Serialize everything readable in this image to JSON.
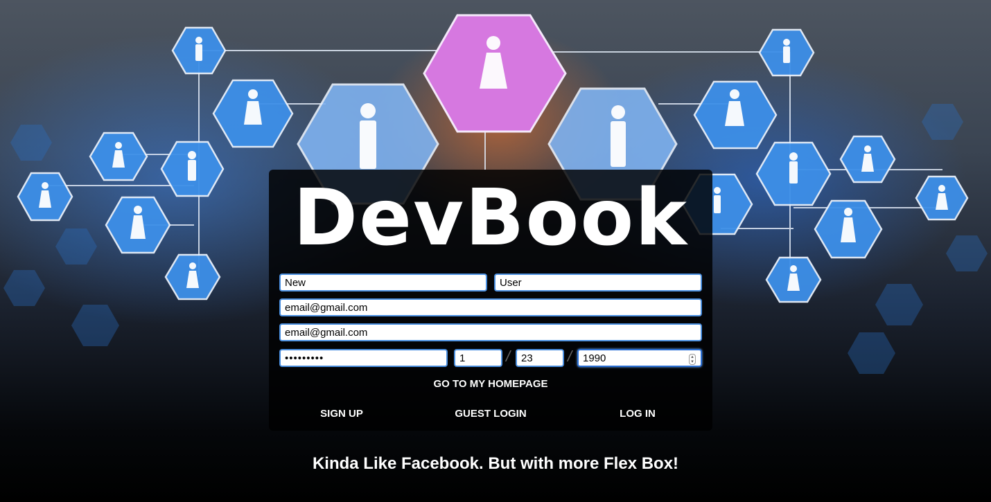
{
  "brand": {
    "logo_text": "DevBook"
  },
  "form": {
    "first_name": "New",
    "last_name": "User",
    "email": "email@gmail.com",
    "email_confirm": "email@gmail.com",
    "password": "•••••••••",
    "birth_month": "1",
    "birth_day": "23",
    "birth_year": "1990",
    "date_separator": "/"
  },
  "actions": {
    "homepage_label": "GO TO MY HOMEPAGE",
    "signup_label": "SIGN UP",
    "guest_label": "GUEST LOGIN",
    "login_label": "LOG IN"
  },
  "tagline": "Kinda Like Facebook. But with more Flex Box!",
  "colors": {
    "card_bg": "#000000",
    "field_border": "#4a8fe0",
    "hex_blue": "#3d8fe8",
    "hex_pink": "#d678e0"
  }
}
